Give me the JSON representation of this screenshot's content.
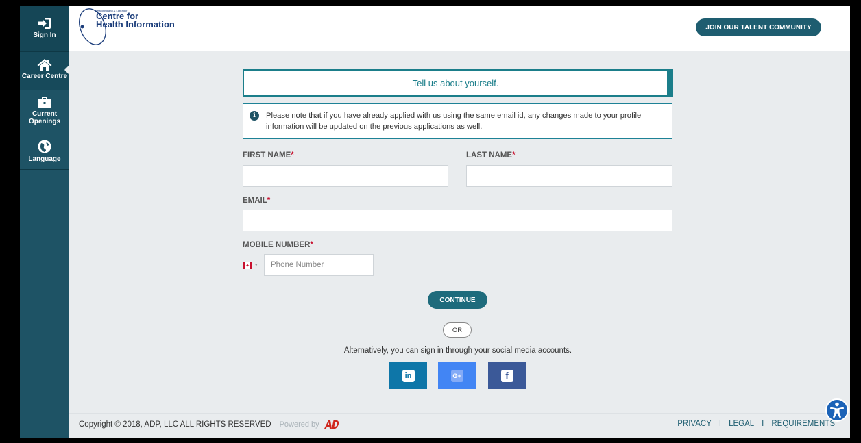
{
  "sidebar": {
    "items": [
      {
        "label": "Sign In",
        "icon": "sign-in-icon"
      },
      {
        "label": "Career Centre",
        "icon": "home-icon"
      },
      {
        "label": "Current Openings",
        "icon": "briefcase-icon"
      },
      {
        "label": "Language",
        "icon": "globe-icon"
      }
    ]
  },
  "header": {
    "logo_small": "Newfoundland & Labrador",
    "logo_line1": "Centre for",
    "logo_line2": "Health Information",
    "join_button": "JOIN OUR TALENT COMMUNITY"
  },
  "form": {
    "banner": "Tell us about yourself.",
    "note": "Please note that if you have already applied with us using the same email id, any changes made to your profile information will be updated on the previous applications as well.",
    "first_name_label": "FIRST NAME",
    "last_name_label": "LAST NAME",
    "email_label": "EMAIL",
    "mobile_label": "MOBILE NUMBER",
    "required_mark": "*",
    "first_name_value": "",
    "last_name_value": "",
    "email_value": "",
    "phone_placeholder": "Phone Number",
    "phone_country": "CA",
    "continue_button": "CONTINUE",
    "or_text": "OR",
    "alt_text": "Alternatively, you can sign in through your social media accounts."
  },
  "social": {
    "linkedin": "in",
    "google": "G+",
    "facebook": "f"
  },
  "footer": {
    "copyright": "Copyright © 2018, ADP, LLC ALL RIGHTS RESERVED",
    "powered_by": "Powered by",
    "links": [
      "PRIVACY",
      "LEGAL",
      "REQUIREMENTS"
    ],
    "separator": "I"
  },
  "colors": {
    "sidebar": "#1e5365",
    "accent": "#1b7e8a",
    "button": "#1e5d70",
    "required": "#c8102e"
  }
}
